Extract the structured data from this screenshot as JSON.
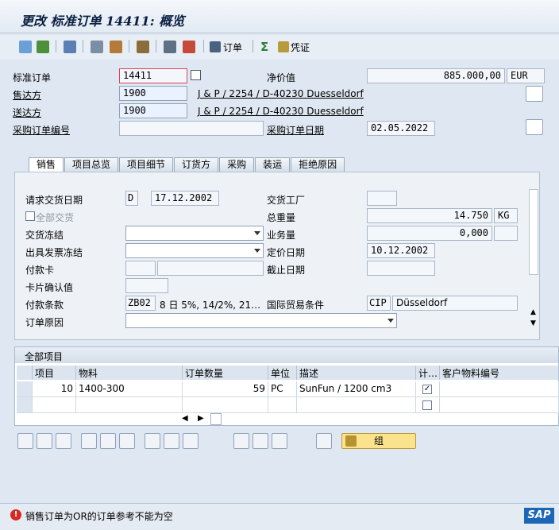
{
  "window": {
    "title": "更改 标准订单 14411: 概览"
  },
  "toolbar": {
    "order_btn": "订单",
    "voucher_btn": "凭证"
  },
  "header": {
    "std_order_label": "标准订单",
    "std_order_value": "14411",
    "net_value_label": "净价值",
    "net_value": "885.000,00",
    "currency": "EUR",
    "sold_to_label": "售达方",
    "sold_to_value": "1900",
    "sold_to_name": "J & P / 2254 / D-40230 Duesseldorf",
    "ship_to_label": "送达方",
    "ship_to_value": "1900",
    "ship_to_name": "J & P / 2254 / D-40230 Duesseldorf",
    "po_number_label": "采购订单编号",
    "po_number_value": "",
    "po_date_label": "采购订单日期",
    "po_date_value": "02.05.2022"
  },
  "tabs": [
    "销售",
    "项目总览",
    "项目细节",
    "订货方",
    "采购",
    "装运",
    "拒绝原因"
  ],
  "sales": {
    "req_delivery_label": "请求交货日期",
    "req_delivery_unit": "D",
    "req_delivery_date": "17.12.2002",
    "plant_label": "交货工厂",
    "plant_value": "",
    "full_delivery_label": "全部交货",
    "gross_weight_label": "总重量",
    "gross_weight": "14.750",
    "weight_unit": "KG",
    "delivery_block_label": "交货冻结",
    "volume_label": "业务量",
    "volume": "0,000",
    "billing_block_label": "出具发票冻结",
    "pricing_date_label": "定价日期",
    "pricing_date": "10.12.2002",
    "payment_card_label": "付款卡",
    "cutoff_label": "截止日期",
    "card_verif_label": "卡片确认值",
    "payment_terms_label": "付款条款",
    "payment_terms_code": "ZB02",
    "payment_terms_text": "8 日 5%, 14/2%, 21…",
    "incoterms_label": "国际贸易条件",
    "incoterms_code": "CIP",
    "incoterms_place": "Düsseldorf",
    "order_reason_label": "订单原因"
  },
  "items": {
    "title": "全部项目",
    "columns": [
      "项目",
      "物料",
      "订单数量",
      "单位",
      "描述",
      "计…",
      "客户物料编号"
    ],
    "rows": [
      {
        "item": "10",
        "material": "1400-300",
        "qty": "59",
        "unit": "PC",
        "desc": "SunFun / 1200 cm3",
        "checked": true
      }
    ]
  },
  "bottom": {
    "group_btn": "组"
  },
  "status": {
    "message": "销售订单为OR的订单参考不能为空",
    "logo": "SAP"
  }
}
